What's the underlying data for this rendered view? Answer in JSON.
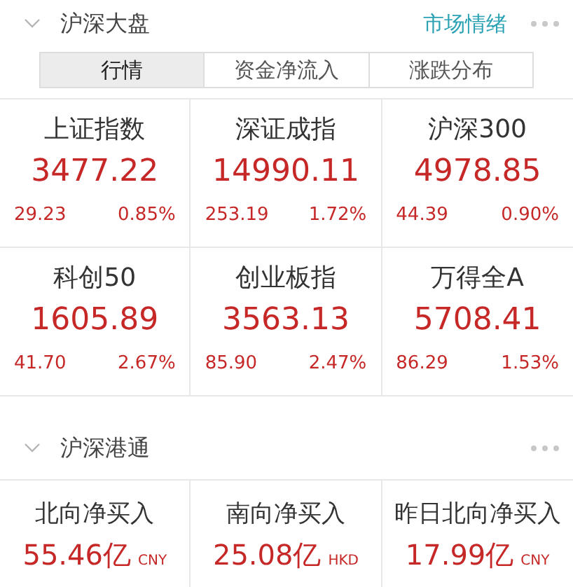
{
  "market_section": {
    "title": "沪深大盘",
    "link": "市场情绪",
    "expanded": true,
    "tabs": [
      {
        "label": "行情",
        "selected": true
      },
      {
        "label": "资金净流入",
        "selected": false
      },
      {
        "label": "涨跌分布",
        "selected": false
      }
    ],
    "indices": [
      {
        "name": "上证指数",
        "value": "3477.22",
        "change": "29.23",
        "percent": "0.85%"
      },
      {
        "name": "深证成指",
        "value": "14990.11",
        "change": "253.19",
        "percent": "1.72%"
      },
      {
        "name": "沪深300",
        "value": "4978.85",
        "change": "44.39",
        "percent": "0.90%"
      },
      {
        "name": "科创50",
        "value": "1605.89",
        "change": "41.70",
        "percent": "2.67%"
      },
      {
        "name": "创业板指",
        "value": "3563.13",
        "change": "85.90",
        "percent": "2.47%"
      },
      {
        "name": "万得全A",
        "value": "5708.41",
        "change": "86.29",
        "percent": "1.53%"
      }
    ]
  },
  "connect_section": {
    "title": "沪深港通",
    "expanded": true,
    "flows": [
      {
        "name": "北向净买入",
        "value": "55.46亿",
        "currency": "CNY"
      },
      {
        "name": "南向净买入",
        "value": "25.08亿",
        "currency": "HKD"
      },
      {
        "name": "昨日北向净买入",
        "value": "17.99亿",
        "currency": "CNY"
      }
    ]
  }
}
